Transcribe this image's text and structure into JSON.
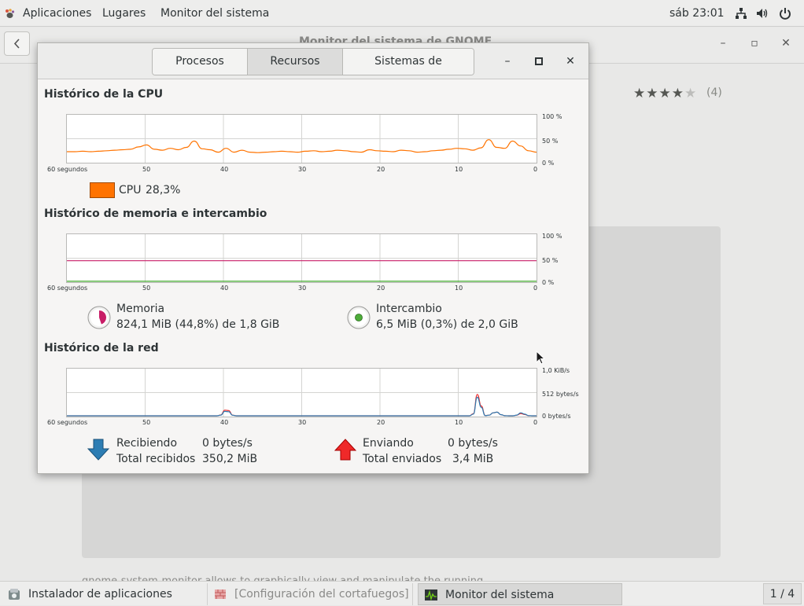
{
  "topbar": {
    "applications": "Aplicaciones",
    "places": "Lugares",
    "app_menu": "Monitor del sistema",
    "clock": "sáb 23:01",
    "icons": [
      "network-icon",
      "volume-icon",
      "power-icon"
    ]
  },
  "background_window": {
    "title": "Monitor del sistema de GNOME",
    "rating_count": "(4)",
    "rating": 4,
    "rating_max": 5,
    "description_fragment": "gnome-system-monitor allows to graphically view and manipulate the running"
  },
  "system_monitor": {
    "tabs": [
      {
        "label": "Procesos",
        "active": false
      },
      {
        "label": "Recursos",
        "active": true
      },
      {
        "label": "Sistemas de archivos",
        "active": false
      }
    ],
    "x_ticks": [
      "60 segundos",
      "50",
      "40",
      "30",
      "20",
      "10",
      "0"
    ],
    "cpu": {
      "title": "Histórico de la CPU",
      "y_ticks": [
        "100 %",
        "50 %",
        "0 %"
      ],
      "legend_label": "CPU",
      "legend_value": "28,3%",
      "color": "#ff7300",
      "values": [
        23,
        23,
        24,
        23,
        24,
        25,
        26,
        27,
        28,
        33,
        37,
        28,
        26,
        30,
        27,
        32,
        45,
        29,
        27,
        22,
        30,
        22,
        26,
        22,
        21,
        22,
        23,
        24,
        23,
        22,
        24,
        25,
        23,
        24,
        26,
        25,
        23,
        22,
        27,
        25,
        24,
        23,
        26,
        25,
        22,
        23,
        25,
        26,
        28,
        30,
        29,
        26,
        31,
        48,
        32,
        30,
        45,
        35,
        25,
        22
      ]
    },
    "memory": {
      "title": "Histórico de memoria e intercambio",
      "y_ticks": [
        "100 %",
        "50 %",
        "0 %"
      ],
      "memory_label": "Memoria",
      "memory_value": "824,1 MiB (44,8%) de 1,8 GiB",
      "memory_color": "#c81d67",
      "memory_percent": 44.8,
      "swap_label": "Intercambio",
      "swap_value": "6,5 MiB (0,3%) de 2,0 GiB",
      "swap_color": "#4ead3a",
      "swap_percent": 0.3
    },
    "network": {
      "title": "Histórico de la red",
      "y_ticks": [
        "1,0 KiB/s",
        "512 bytes/s",
        "0 bytes/s"
      ],
      "receiving_label": "Recibiendo",
      "receiving_value": "0 bytes/s",
      "total_received_label": "Total recibidos",
      "total_received_value": "350,2 MiB",
      "sending_label": "Enviando",
      "sending_value": "0 bytes/s",
      "total_sent_label": "Total enviados",
      "total_sent_value": "3,4 MiB",
      "receive_color": "#2d7db3",
      "send_color": "#ef2929"
    }
  },
  "taskbar": {
    "items": [
      {
        "label": "Instalador de aplicaciones"
      },
      {
        "label": "[Configuración del cortafuegos]"
      },
      {
        "label": "Monitor del sistema"
      }
    ],
    "workspace": "1 / 4"
  }
}
